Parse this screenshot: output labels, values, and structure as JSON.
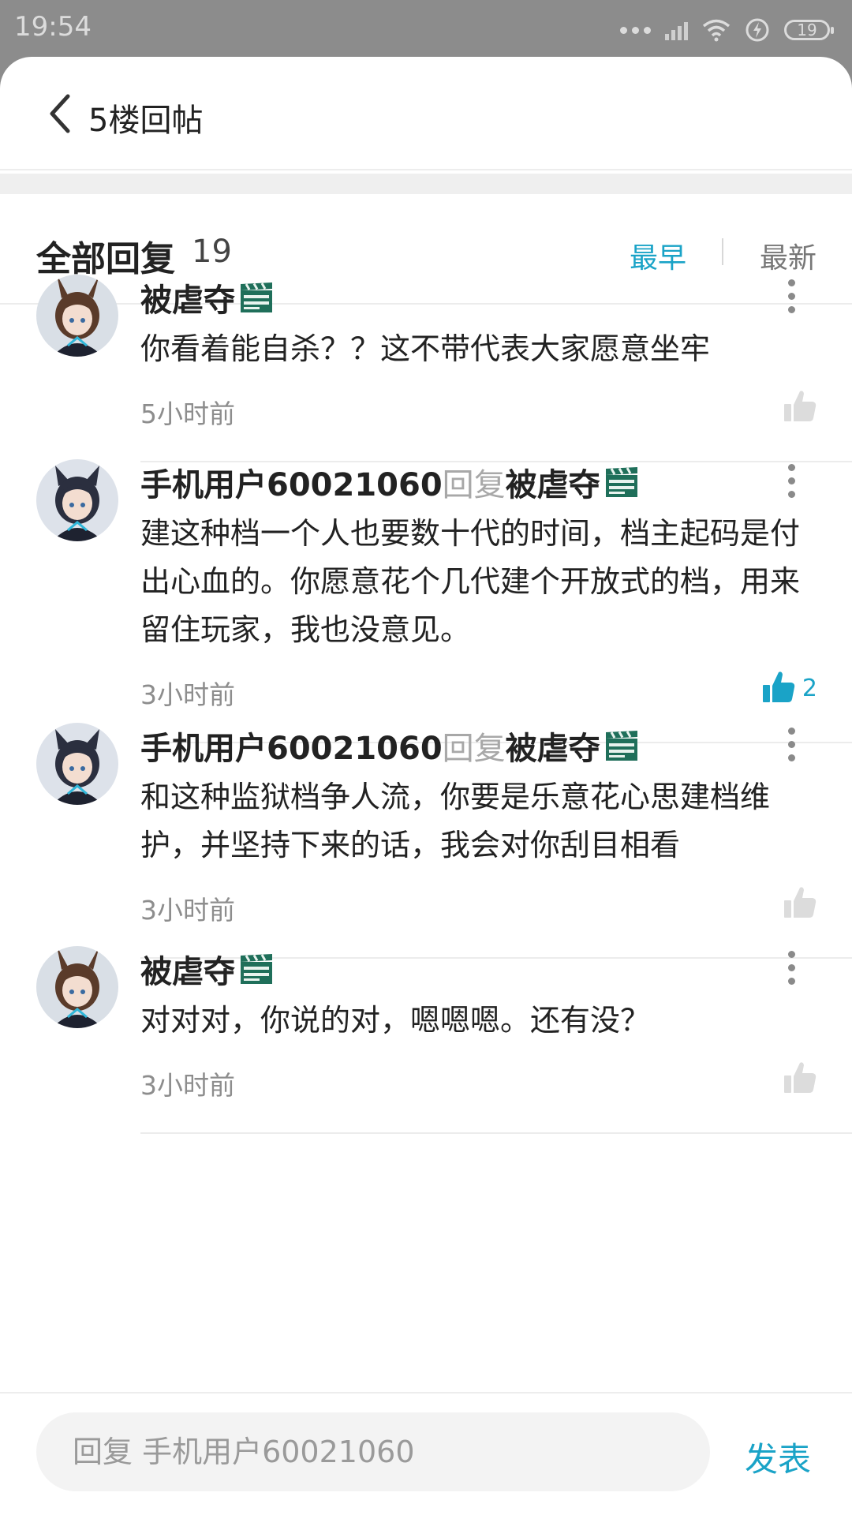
{
  "status_bar": {
    "time": "19:54",
    "battery": "19"
  },
  "header": {
    "title": "5楼回帖"
  },
  "replies_header": {
    "label": "全部回复",
    "count": "19",
    "sort_earliest": "最早",
    "sort_latest": "最新"
  },
  "comments": [
    {
      "username": "被虐夺",
      "reply_word": "",
      "reply_to": "",
      "text": "你看着能自杀？？这不带代表大家愿意坐牢",
      "time": "5小时前",
      "likes": "",
      "liked": false,
      "avatar": "rabbit-ear-girl"
    },
    {
      "username": "手机用户60021060",
      "reply_word": "回复",
      "reply_to": "被虐夺",
      "text": "建这种档一个人也要数十代的时间，档主起码是付出心血的。你愿意花个几代建个开放式的档，用来留住玩家，我也没意见。",
      "time": "3小时前",
      "likes": "2",
      "liked": true,
      "avatar": "wolf-ear-girl"
    },
    {
      "username": "手机用户60021060",
      "reply_word": "回复",
      "reply_to": "被虐夺",
      "text": "和这种监狱档争人流，你要是乐意花心思建档维护，并坚持下来的话，我会对你刮目相看",
      "time": "3小时前",
      "likes": "",
      "liked": false,
      "avatar": "wolf-ear-girl"
    },
    {
      "username": "被虐夺",
      "reply_word": "",
      "reply_to": "",
      "text": "对对对，你说的对，嗯嗯嗯。还有没？",
      "time": "3小时前",
      "likes": "",
      "liked": false,
      "avatar": "rabbit-ear-girl"
    }
  ],
  "input": {
    "placeholder": "回复 手机用户60021060",
    "send_label": "发表"
  },
  "colors": {
    "accent": "#1aa3c7",
    "badge": "#1f6f5a"
  }
}
